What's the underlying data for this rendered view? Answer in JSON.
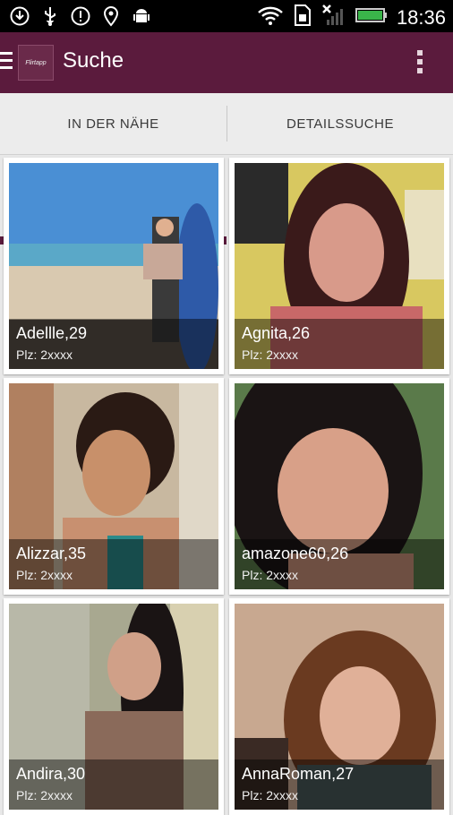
{
  "status_bar": {
    "time": "18:36",
    "left_icons": [
      "download-icon",
      "usb-icon",
      "alert-icon",
      "location-icon",
      "android-icon"
    ],
    "right_icons": [
      "wifi-icon",
      "sim-icon",
      "signal-icon",
      "battery-icon"
    ]
  },
  "app_bar": {
    "title": "Suche",
    "logo_text": "Flirtapp"
  },
  "tabs": [
    {
      "label": "IN DER NÄHE",
      "selected": true
    },
    {
      "label": "DETAILSSUCHE",
      "selected": false
    }
  ],
  "profiles": [
    {
      "name": "Adellle,29",
      "plz": "Plz: 2xxxx"
    },
    {
      "name": "Agnita,26",
      "plz": "Plz: 2xxxx"
    },
    {
      "name": "Alizzar,35",
      "plz": "Plz: 2xxxx"
    },
    {
      "name": "amazone60,26",
      "plz": "Plz: 2xxxx"
    },
    {
      "name": "Andira,30",
      "plz": "Plz: 2xxxx"
    },
    {
      "name": "AnnaRoman,27",
      "plz": "Plz: 2xxxx"
    }
  ],
  "colors": {
    "primary": "#5b1b3d",
    "status_bar": "#000000",
    "tab_background": "#ececec"
  }
}
